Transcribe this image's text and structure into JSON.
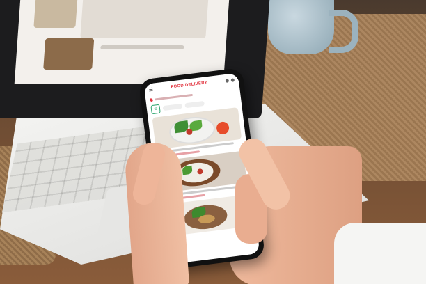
{
  "scene": {
    "description_tags": [
      "laptop",
      "smartphone",
      "hands",
      "coffee-mug",
      "wooden-table"
    ]
  },
  "phone_app": {
    "brand": "FOOD DELIVERY",
    "filter_icon": "filter-icon",
    "header_icons": [
      "cart-icon",
      "user-icon",
      "menu-icon"
    ],
    "feed": [
      {
        "dish": "salad-bowl"
      },
      {
        "dish": "vegetable-plate"
      },
      {
        "dish": "chickpea-bowl"
      }
    ]
  },
  "colors": {
    "brand_red": "#e2343f",
    "accent_green": "#27a36a"
  }
}
